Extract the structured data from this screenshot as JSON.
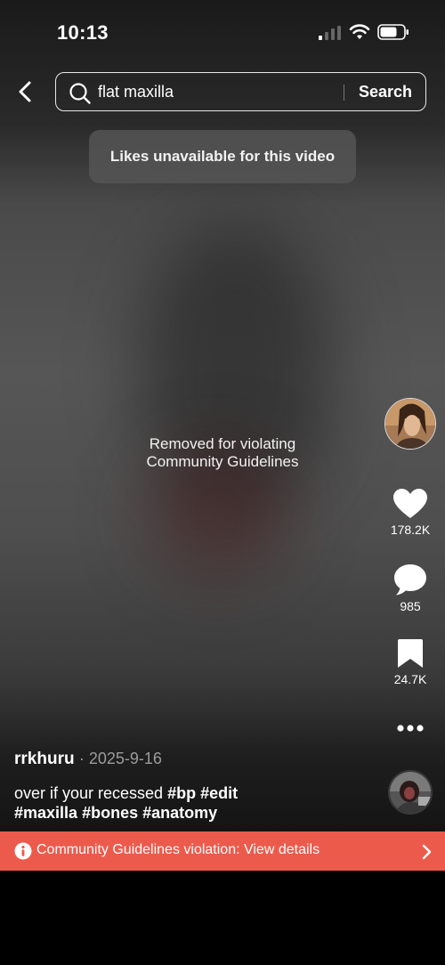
{
  "status_bar": {
    "time": "10:13"
  },
  "search": {
    "query": "flat maxilla",
    "button_label": "Search"
  },
  "toast": {
    "text": "Likes unavailable for this video"
  },
  "video": {
    "removed_line1": "Removed for violating",
    "removed_line2": "Community Guidelines"
  },
  "actions": {
    "likes": "178.2K",
    "comments": "985",
    "saves": "24.7K"
  },
  "post": {
    "author": "rrkhuru",
    "date": "· 2025-9-16",
    "caption_text": "over if your recessed",
    "hashtags": [
      "#bp",
      "#edit",
      "#maxilla",
      "#bones",
      "#anatomy"
    ]
  },
  "banner": {
    "text": "Community Guidelines violation: View details"
  },
  "icons": [
    "signal-icon",
    "wifi-icon",
    "battery-icon",
    "back-arrow-icon",
    "search-icon",
    "heart-icon",
    "comment-icon",
    "bookmark-icon",
    "more-icon",
    "info-icon",
    "chevron-right-icon"
  ],
  "colors": {
    "banner": "#ec5a4c",
    "background": "#000000"
  }
}
